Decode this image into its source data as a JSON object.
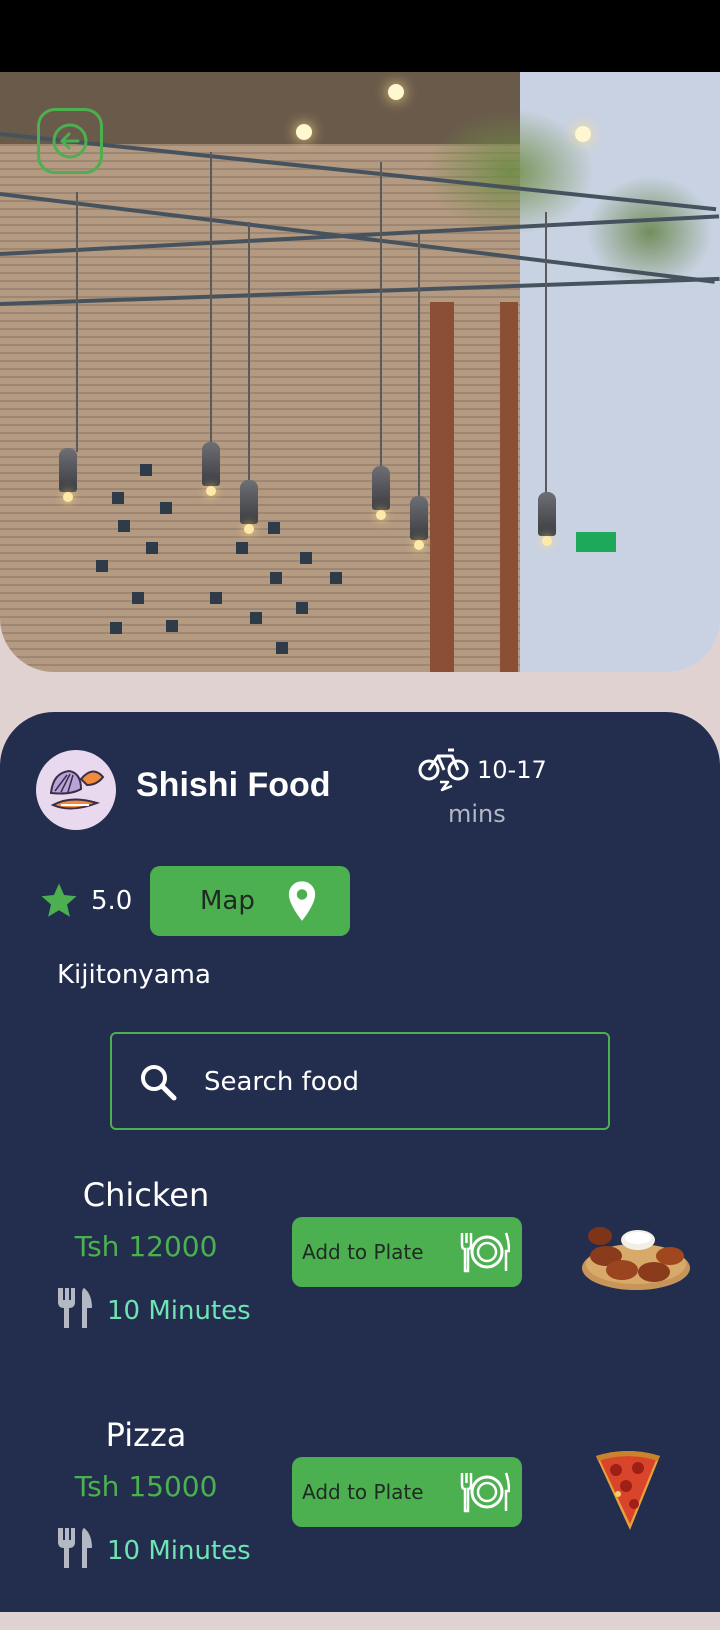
{
  "header": {
    "back_icon": "arrow-left-icon"
  },
  "restaurant": {
    "name": "Shishi Food",
    "avatar_icon": "seafood-logo-icon",
    "delivery_icon": "bicycle-icon",
    "delivery_time": "10-17",
    "delivery_unit": "mins",
    "rating": "5.0",
    "rating_icon": "star-icon",
    "map_label": "Map",
    "map_icon": "location-pin-icon",
    "location": "Kijitonyama"
  },
  "search": {
    "placeholder": "Search food",
    "icon": "search-icon"
  },
  "foods": [
    {
      "name": "Chicken",
      "price": "Tsh 12000",
      "time": "10 Minutes",
      "button_label": "Add to Plate",
      "image_icon": "chicken-wings-image"
    },
    {
      "name": "Pizza",
      "price": "Tsh 15000",
      "time": "10 Minutes",
      "button_label": "Add to Plate",
      "image_icon": "pizza-slice-image"
    }
  ],
  "colors": {
    "accent": "#4caf50",
    "card_bg": "#232e4e",
    "time_text": "#6ee3b4"
  }
}
